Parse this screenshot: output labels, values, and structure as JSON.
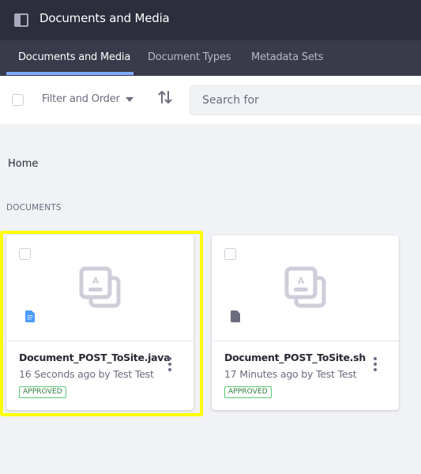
{
  "header": {
    "panel_icon": "sidebar-toggle-icon",
    "title": "Documents and Media"
  },
  "nav": {
    "tabs": [
      {
        "label": "Documents and Media",
        "active": true
      },
      {
        "label": "Document Types",
        "active": false
      },
      {
        "label": "Metadata Sets",
        "active": false
      }
    ]
  },
  "toolbar": {
    "filter_label": "Filter and Order",
    "filter_icon": "caret-down-icon",
    "sort_icon": "order-arrows-icon",
    "search_placeholder": "Search for",
    "search_value": ""
  },
  "breadcrumb": {
    "label": "Home"
  },
  "section": {
    "title": "DOCUMENTS"
  },
  "colors": {
    "topbar": "#2c2e3c",
    "navbar": "#393a4a",
    "active_tab_underline": "#80acff",
    "highlight": "#ffff00",
    "approved_border": "#5aca75",
    "approved_text": "#287d3c",
    "java_icon": "#4b9bff",
    "sh_icon": "#6b6c7e"
  },
  "documents": [
    {
      "title": "Document_POST_ToSite.java",
      "subtitle": "16 Seconds ago by Test Test",
      "status": "APPROVED",
      "file_icon": "blue-text-document-icon",
      "highlighted": true
    },
    {
      "title": "Document_POST_ToSite.sh",
      "subtitle": "17 Minutes ago by Test Test",
      "status": "APPROVED",
      "file_icon": "gray-document-icon",
      "highlighted": false
    }
  ]
}
